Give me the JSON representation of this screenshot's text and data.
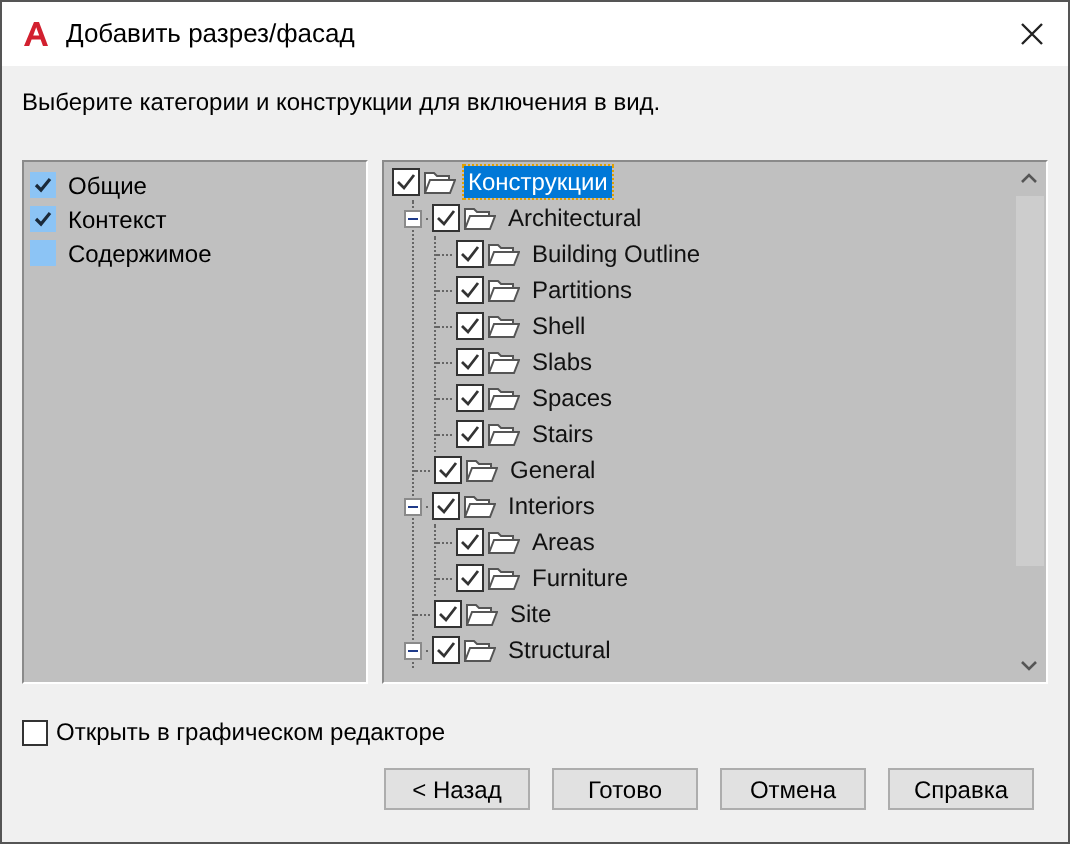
{
  "window": {
    "title": "Добавить разрез/фасад"
  },
  "instruction": "Выберите категории и конструкции для включения в вид.",
  "categories": [
    {
      "label": "Общие",
      "checked": true
    },
    {
      "label": "Контекст",
      "checked": true
    },
    {
      "label": "Содержимое",
      "checked": false
    }
  ],
  "tree": {
    "label": "Конструкции",
    "checked": true,
    "selected": true,
    "children": [
      {
        "label": "Architectural",
        "checked": true,
        "selected": false,
        "expanded": true,
        "children": [
          {
            "label": "Building Outline",
            "checked": true,
            "selected": false
          },
          {
            "label": "Partitions",
            "checked": true,
            "selected": false
          },
          {
            "label": "Shell",
            "checked": true,
            "selected": false
          },
          {
            "label": "Slabs",
            "checked": true,
            "selected": false
          },
          {
            "label": "Spaces",
            "checked": true,
            "selected": false
          },
          {
            "label": "Stairs",
            "checked": true,
            "selected": false
          }
        ]
      },
      {
        "label": "General",
        "checked": true,
        "selected": false
      },
      {
        "label": "Interiors",
        "checked": true,
        "selected": false,
        "expanded": true,
        "children": [
          {
            "label": "Areas",
            "checked": true,
            "selected": false
          },
          {
            "label": "Furniture",
            "checked": true,
            "selected": false
          }
        ]
      },
      {
        "label": "Site",
        "checked": true,
        "selected": false
      },
      {
        "label": "Structural",
        "checked": true,
        "selected": false,
        "expanded": true
      }
    ]
  },
  "open_in_editor": {
    "label": "Открыть в графическом редакторе",
    "checked": false
  },
  "buttons": [
    "< Назад",
    "Готово",
    "Отмена",
    "Справка"
  ]
}
